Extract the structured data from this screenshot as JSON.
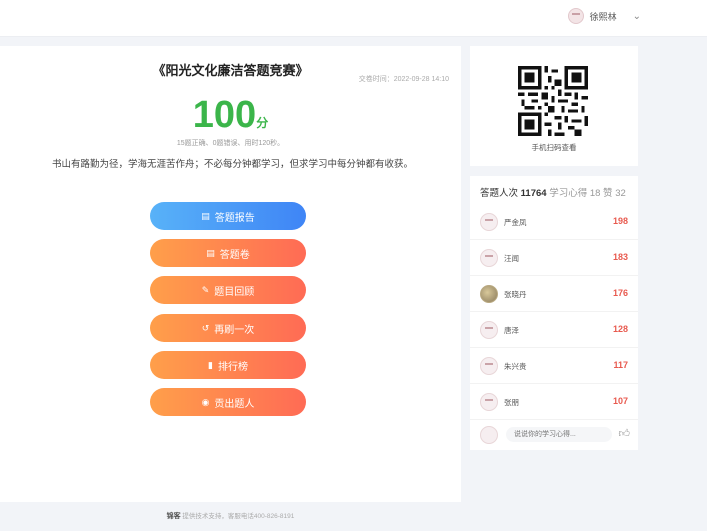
{
  "header": {
    "username": "徐熙林",
    "dropdown_icon": "chevron-down-icon"
  },
  "quiz": {
    "title": "《阳光文化廉洁答题竞赛》",
    "submit_time": "交卷时间：2022-09-28 14:10",
    "score": "100",
    "score_unit": "分",
    "summary": "15题正确、0题错误、用时120秒。",
    "quote": "书山有路勤为径，学海无涯苦作舟；不必每分钟都学习，但求学习中每分钟都有收获。"
  },
  "buttons": [
    {
      "label": "答题报告",
      "icon": "report-icon",
      "color": "#4a90f5"
    },
    {
      "label": "答题卷",
      "icon": "paper-icon",
      "color": "#ff7a50"
    },
    {
      "label": "题目回顾",
      "icon": "review-icon",
      "color": "#ff7a50"
    },
    {
      "label": "再刷一次",
      "icon": "redo-icon",
      "color": "#ff7a50"
    },
    {
      "label": "排行榜",
      "icon": "ranking-icon",
      "color": "#ff7a50"
    },
    {
      "label": "贡出题人",
      "icon": "reward-icon",
      "color": "#ff7a50"
    }
  ],
  "qr": {
    "caption": "手机扫码查看"
  },
  "ranking": {
    "label": "答题人次",
    "count": "11764",
    "stats": "学习心得 18  赞 32",
    "rows": [
      {
        "name": "严金凤",
        "score": "198"
      },
      {
        "name": "汪闻",
        "score": "183"
      },
      {
        "name": "张晓丹",
        "score": "176"
      },
      {
        "name": "唐泽",
        "score": "128"
      },
      {
        "name": "朱兴贵",
        "score": "117"
      },
      {
        "name": "张朋",
        "score": "107"
      }
    ],
    "comment_placeholder": "说说你的学习心得..."
  },
  "footer": {
    "brand": "锦客",
    "text": "提供技术支持，客服电话400-826-8191"
  },
  "colors": {
    "score_green": "#3bb54a",
    "rank_red": "#e85a4f",
    "btn_blue": "#4a90f5",
    "btn_orange": "#ff7a50"
  }
}
